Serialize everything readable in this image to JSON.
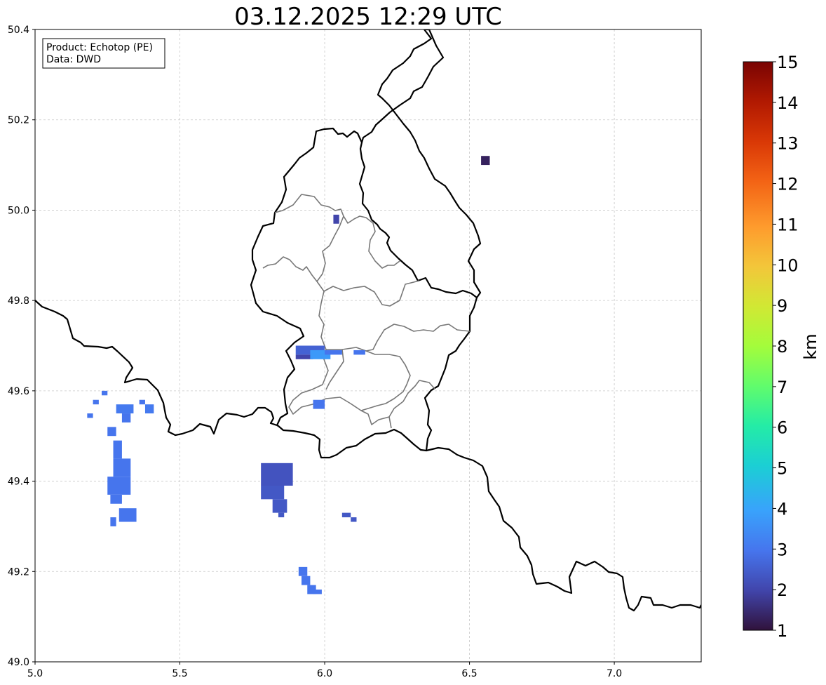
{
  "title": "03.12.2025 12:29 UTC",
  "info_box": {
    "product_line": "Product: Echotop (PE)",
    "data_line": "Data: DWD"
  },
  "map": {
    "projection": "lon-lat",
    "x_range": [
      5.0,
      7.3
    ],
    "y_range": [
      49.0,
      50.4
    ],
    "x_ticks": [
      "5.0",
      "5.5",
      "6.0",
      "6.5",
      "7.0"
    ],
    "y_ticks": [
      "49.0",
      "49.2",
      "49.4",
      "49.6",
      "49.8",
      "50.0",
      "50.2",
      "50.4"
    ],
    "grid": true
  },
  "colorbar": {
    "label": "km",
    "min": 1,
    "max": 15,
    "ticks": [
      "1",
      "2",
      "3",
      "4",
      "5",
      "6",
      "7",
      "8",
      "9",
      "10",
      "11",
      "12",
      "13",
      "14",
      "15"
    ],
    "colormap": "turbo"
  },
  "chart_data": {
    "type": "heatmap",
    "title": "03.12.2025 12:29 UTC",
    "xlim": [
      5.0,
      7.3
    ],
    "ylim": [
      49.0,
      50.4
    ],
    "unit": "km",
    "echo_areas": [
      {
        "lon": [
          5.36,
          5.38
        ],
        "lat": [
          49.57,
          49.58
        ],
        "km": 3.0
      },
      {
        "lon": [
          5.23,
          5.25
        ],
        "lat": [
          49.59,
          49.6
        ],
        "km": 3.0
      },
      {
        "lon": [
          5.2,
          5.22
        ],
        "lat": [
          49.57,
          49.58
        ],
        "km": 3.0
      },
      {
        "lon": [
          5.18,
          5.2
        ],
        "lat": [
          49.54,
          49.55
        ],
        "km": 3.0
      },
      {
        "lon": [
          5.28,
          5.34
        ],
        "lat": [
          49.55,
          49.57
        ],
        "km": 3.1
      },
      {
        "lon": [
          5.38,
          5.41
        ],
        "lat": [
          49.55,
          49.57
        ],
        "km": 3.1
      },
      {
        "lon": [
          5.3,
          5.33
        ],
        "lat": [
          49.53,
          49.55
        ],
        "km": 3.0
      },
      {
        "lon": [
          5.25,
          5.28
        ],
        "lat": [
          49.5,
          49.52
        ],
        "km": 3.0
      },
      {
        "lon": [
          5.27,
          5.3
        ],
        "lat": [
          49.45,
          49.49
        ],
        "km": 3.0
      },
      {
        "lon": [
          5.27,
          5.33
        ],
        "lat": [
          49.41,
          49.45
        ],
        "km": 3.0
      },
      {
        "lon": [
          5.25,
          5.33
        ],
        "lat": [
          49.37,
          49.41
        ],
        "km": 3.0
      },
      {
        "lon": [
          5.26,
          5.3
        ],
        "lat": [
          49.35,
          49.37
        ],
        "km": 3.0
      },
      {
        "lon": [
          5.29,
          5.35
        ],
        "lat": [
          49.31,
          49.34
        ],
        "km": 3.0
      },
      {
        "lon": [
          5.26,
          5.28
        ],
        "lat": [
          49.3,
          49.32
        ],
        "km": 3.0
      },
      {
        "lon": [
          5.78,
          5.89
        ],
        "lat": [
          49.39,
          49.44
        ],
        "km": 2.3
      },
      {
        "lon": [
          5.78,
          5.86
        ],
        "lat": [
          49.36,
          49.39
        ],
        "km": 2.4
      },
      {
        "lon": [
          5.82,
          5.87
        ],
        "lat": [
          49.33,
          49.36
        ],
        "km": 2.4
      },
      {
        "lon": [
          5.84,
          5.86
        ],
        "lat": [
          49.32,
          49.33
        ],
        "km": 2.4
      },
      {
        "lon": [
          6.06,
          6.09
        ],
        "lat": [
          49.32,
          49.33
        ],
        "km": 2.4
      },
      {
        "lon": [
          6.09,
          6.11
        ],
        "lat": [
          49.31,
          49.32
        ],
        "km": 2.4
      },
      {
        "lon": [
          5.91,
          5.94
        ],
        "lat": [
          49.19,
          49.21
        ],
        "km": 3.0
      },
      {
        "lon": [
          5.92,
          5.95
        ],
        "lat": [
          49.17,
          49.19
        ],
        "km": 3.0
      },
      {
        "lon": [
          5.94,
          5.97
        ],
        "lat": [
          49.15,
          49.17
        ],
        "km": 3.0
      },
      {
        "lon": [
          5.96,
          5.99
        ],
        "lat": [
          49.15,
          49.16
        ],
        "km": 3.0
      },
      {
        "lon": [
          5.9,
          6.0
        ],
        "lat": [
          49.68,
          49.7
        ],
        "km": 2.6
      },
      {
        "lon": [
          5.9,
          5.96
        ],
        "lat": [
          49.67,
          49.68
        ],
        "km": 2.0
      },
      {
        "lon": [
          5.95,
          6.02
        ],
        "lat": [
          49.67,
          49.69
        ],
        "km": 3.8
      },
      {
        "lon": [
          6.0,
          6.06
        ],
        "lat": [
          49.68,
          49.69
        ],
        "km": 3.0
      },
      {
        "lon": [
          6.1,
          6.14
        ],
        "lat": [
          49.68,
          49.69
        ],
        "km": 3.0
      },
      {
        "lon": [
          5.96,
          6.0
        ],
        "lat": [
          49.56,
          49.58
        ],
        "km": 3.0
      },
      {
        "lon": [
          6.03,
          6.05
        ],
        "lat": [
          49.97,
          49.99
        ],
        "km": 2.0
      },
      {
        "lon": [
          6.54,
          6.57
        ],
        "lat": [
          50.1,
          50.12
        ],
        "km": 1.3
      }
    ]
  }
}
